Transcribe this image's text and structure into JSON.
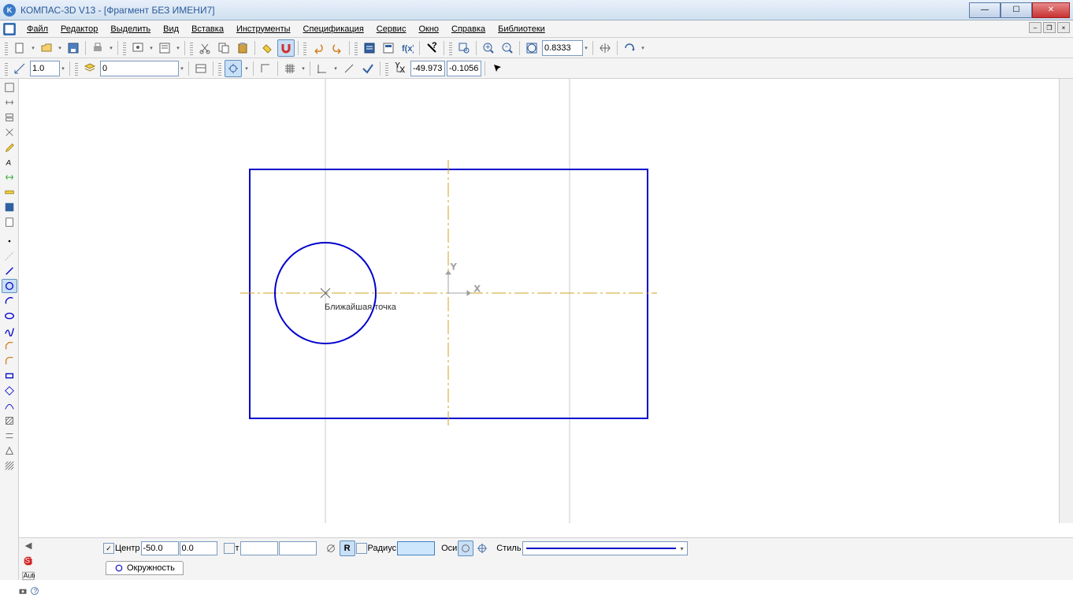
{
  "title": "КОМПАС-3D V13 - [Фрагмент БЕЗ ИМЕНИ7]",
  "menu": {
    "file": "Файл",
    "edit": "Редактор",
    "select": "Выделить",
    "view": "Вид",
    "insert": "Вставка",
    "tools": "Инструменты",
    "spec": "Спецификация",
    "service": "Сервис",
    "window": "Окно",
    "help": "Справка",
    "libs": "Библиотеки"
  },
  "toolbar1": {
    "zoom_value": "0.8333"
  },
  "toolbar2": {
    "scale": "1.0",
    "layer": "0",
    "coord_x": "-49.973",
    "coord_y": "-0.1056"
  },
  "canvas": {
    "snap_hint": "Ближайшая точка"
  },
  "props": {
    "center_label": "Центр",
    "center_x": "-50.0",
    "center_y": "0.0",
    "t": "т",
    "r_label": "R",
    "radius_label": "Радиус",
    "radius_value": "",
    "axes_label": "Оси",
    "style_label": "Стиль",
    "tab": "Окружность"
  }
}
